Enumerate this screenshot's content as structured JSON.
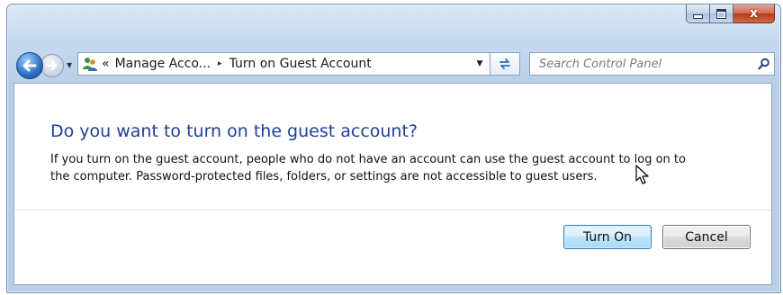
{
  "window": {
    "caption_buttons": {
      "minimize_icon": "minimize-icon",
      "maximize_icon": "maximize-icon",
      "close_icon": "close-icon",
      "close_glyph": "x"
    }
  },
  "nav": {
    "back_icon": "back-arrow-icon",
    "forward_icon": "forward-arrow-icon",
    "history_icon": "chevron-down-icon",
    "address": {
      "icon": "user-accounts-icon",
      "prefix": "«",
      "crumbs": [
        "Manage Acco...",
        "Turn on Guest Account"
      ],
      "separator": "▸",
      "dropdown_icon": "chevron-down-icon"
    },
    "refresh_icon": "refresh-icon",
    "search": {
      "placeholder": "Search Control Panel",
      "icon": "search-icon"
    }
  },
  "content": {
    "heading": "Do you want to turn on the guest account?",
    "description_lines": [
      "If you turn on the guest account, people who do not have an account can use the guest account to log on to",
      "the computer. Password-protected files, folders, or settings are not accessible to guest users."
    ],
    "buttons": {
      "primary": "Turn On",
      "cancel": "Cancel"
    }
  },
  "colors": {
    "heading": "#1e3f95",
    "frame": "#b9cfe8",
    "close_button": "#c24a2c",
    "primary_button_border": "#3c7fb1"
  }
}
